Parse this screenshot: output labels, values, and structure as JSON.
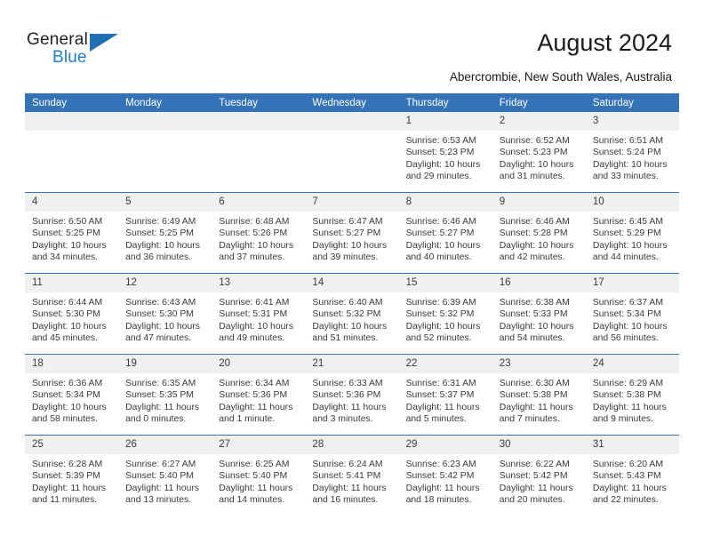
{
  "brand": {
    "name_part1": "General",
    "name_part2": "Blue",
    "triangle_color": "#1f6fb4",
    "blue_text_color": "#1f7ec4"
  },
  "header": {
    "title": "August 2024",
    "subtitle": "Abercrombie, New South Wales, Australia",
    "accent_color": "#3573b8",
    "daynum_band_color": "#f0f0f0"
  },
  "weekday_headers": [
    "Sunday",
    "Monday",
    "Tuesday",
    "Wednesday",
    "Thursday",
    "Friday",
    "Saturday"
  ],
  "labels": {
    "sunrise_prefix": "Sunrise:",
    "sunset_prefix": "Sunset:",
    "daylight_prefix": "Daylight:"
  },
  "weeks": [
    [
      {
        "day": "",
        "empty": true
      },
      {
        "day": "",
        "empty": true
      },
      {
        "day": "",
        "empty": true
      },
      {
        "day": "",
        "empty": true
      },
      {
        "day": "1",
        "sunrise": "Sunrise: 6:53 AM",
        "sunset": "Sunset: 5:23 PM",
        "daylight1": "Daylight: 10 hours",
        "daylight2": "and 29 minutes."
      },
      {
        "day": "2",
        "sunrise": "Sunrise: 6:52 AM",
        "sunset": "Sunset: 5:23 PM",
        "daylight1": "Daylight: 10 hours",
        "daylight2": "and 31 minutes."
      },
      {
        "day": "3",
        "sunrise": "Sunrise: 6:51 AM",
        "sunset": "Sunset: 5:24 PM",
        "daylight1": "Daylight: 10 hours",
        "daylight2": "and 33 minutes."
      }
    ],
    [
      {
        "day": "4",
        "sunrise": "Sunrise: 6:50 AM",
        "sunset": "Sunset: 5:25 PM",
        "daylight1": "Daylight: 10 hours",
        "daylight2": "and 34 minutes."
      },
      {
        "day": "5",
        "sunrise": "Sunrise: 6:49 AM",
        "sunset": "Sunset: 5:25 PM",
        "daylight1": "Daylight: 10 hours",
        "daylight2": "and 36 minutes."
      },
      {
        "day": "6",
        "sunrise": "Sunrise: 6:48 AM",
        "sunset": "Sunset: 5:26 PM",
        "daylight1": "Daylight: 10 hours",
        "daylight2": "and 37 minutes."
      },
      {
        "day": "7",
        "sunrise": "Sunrise: 6:47 AM",
        "sunset": "Sunset: 5:27 PM",
        "daylight1": "Daylight: 10 hours",
        "daylight2": "and 39 minutes."
      },
      {
        "day": "8",
        "sunrise": "Sunrise: 6:46 AM",
        "sunset": "Sunset: 5:27 PM",
        "daylight1": "Daylight: 10 hours",
        "daylight2": "and 40 minutes."
      },
      {
        "day": "9",
        "sunrise": "Sunrise: 6:46 AM",
        "sunset": "Sunset: 5:28 PM",
        "daylight1": "Daylight: 10 hours",
        "daylight2": "and 42 minutes."
      },
      {
        "day": "10",
        "sunrise": "Sunrise: 6:45 AM",
        "sunset": "Sunset: 5:29 PM",
        "daylight1": "Daylight: 10 hours",
        "daylight2": "and 44 minutes."
      }
    ],
    [
      {
        "day": "11",
        "sunrise": "Sunrise: 6:44 AM",
        "sunset": "Sunset: 5:30 PM",
        "daylight1": "Daylight: 10 hours",
        "daylight2": "and 45 minutes."
      },
      {
        "day": "12",
        "sunrise": "Sunrise: 6:43 AM",
        "sunset": "Sunset: 5:30 PM",
        "daylight1": "Daylight: 10 hours",
        "daylight2": "and 47 minutes."
      },
      {
        "day": "13",
        "sunrise": "Sunrise: 6:41 AM",
        "sunset": "Sunset: 5:31 PM",
        "daylight1": "Daylight: 10 hours",
        "daylight2": "and 49 minutes."
      },
      {
        "day": "14",
        "sunrise": "Sunrise: 6:40 AM",
        "sunset": "Sunset: 5:32 PM",
        "daylight1": "Daylight: 10 hours",
        "daylight2": "and 51 minutes."
      },
      {
        "day": "15",
        "sunrise": "Sunrise: 6:39 AM",
        "sunset": "Sunset: 5:32 PM",
        "daylight1": "Daylight: 10 hours",
        "daylight2": "and 52 minutes."
      },
      {
        "day": "16",
        "sunrise": "Sunrise: 6:38 AM",
        "sunset": "Sunset: 5:33 PM",
        "daylight1": "Daylight: 10 hours",
        "daylight2": "and 54 minutes."
      },
      {
        "day": "17",
        "sunrise": "Sunrise: 6:37 AM",
        "sunset": "Sunset: 5:34 PM",
        "daylight1": "Daylight: 10 hours",
        "daylight2": "and 56 minutes."
      }
    ],
    [
      {
        "day": "18",
        "sunrise": "Sunrise: 6:36 AM",
        "sunset": "Sunset: 5:34 PM",
        "daylight1": "Daylight: 10 hours",
        "daylight2": "and 58 minutes."
      },
      {
        "day": "19",
        "sunrise": "Sunrise: 6:35 AM",
        "sunset": "Sunset: 5:35 PM",
        "daylight1": "Daylight: 11 hours",
        "daylight2": "and 0 minutes."
      },
      {
        "day": "20",
        "sunrise": "Sunrise: 6:34 AM",
        "sunset": "Sunset: 5:36 PM",
        "daylight1": "Daylight: 11 hours",
        "daylight2": "and 1 minute."
      },
      {
        "day": "21",
        "sunrise": "Sunrise: 6:33 AM",
        "sunset": "Sunset: 5:36 PM",
        "daylight1": "Daylight: 11 hours",
        "daylight2": "and 3 minutes."
      },
      {
        "day": "22",
        "sunrise": "Sunrise: 6:31 AM",
        "sunset": "Sunset: 5:37 PM",
        "daylight1": "Daylight: 11 hours",
        "daylight2": "and 5 minutes."
      },
      {
        "day": "23",
        "sunrise": "Sunrise: 6:30 AM",
        "sunset": "Sunset: 5:38 PM",
        "daylight1": "Daylight: 11 hours",
        "daylight2": "and 7 minutes."
      },
      {
        "day": "24",
        "sunrise": "Sunrise: 6:29 AM",
        "sunset": "Sunset: 5:38 PM",
        "daylight1": "Daylight: 11 hours",
        "daylight2": "and 9 minutes."
      }
    ],
    [
      {
        "day": "25",
        "sunrise": "Sunrise: 6:28 AM",
        "sunset": "Sunset: 5:39 PM",
        "daylight1": "Daylight: 11 hours",
        "daylight2": "and 11 minutes."
      },
      {
        "day": "26",
        "sunrise": "Sunrise: 6:27 AM",
        "sunset": "Sunset: 5:40 PM",
        "daylight1": "Daylight: 11 hours",
        "daylight2": "and 13 minutes."
      },
      {
        "day": "27",
        "sunrise": "Sunrise: 6:25 AM",
        "sunset": "Sunset: 5:40 PM",
        "daylight1": "Daylight: 11 hours",
        "daylight2": "and 14 minutes."
      },
      {
        "day": "28",
        "sunrise": "Sunrise: 6:24 AM",
        "sunset": "Sunset: 5:41 PM",
        "daylight1": "Daylight: 11 hours",
        "daylight2": "and 16 minutes."
      },
      {
        "day": "29",
        "sunrise": "Sunrise: 6:23 AM",
        "sunset": "Sunset: 5:42 PM",
        "daylight1": "Daylight: 11 hours",
        "daylight2": "and 18 minutes."
      },
      {
        "day": "30",
        "sunrise": "Sunrise: 6:22 AM",
        "sunset": "Sunset: 5:42 PM",
        "daylight1": "Daylight: 11 hours",
        "daylight2": "and 20 minutes."
      },
      {
        "day": "31",
        "sunrise": "Sunrise: 6:20 AM",
        "sunset": "Sunset: 5:43 PM",
        "daylight1": "Daylight: 11 hours",
        "daylight2": "and 22 minutes."
      }
    ]
  ]
}
